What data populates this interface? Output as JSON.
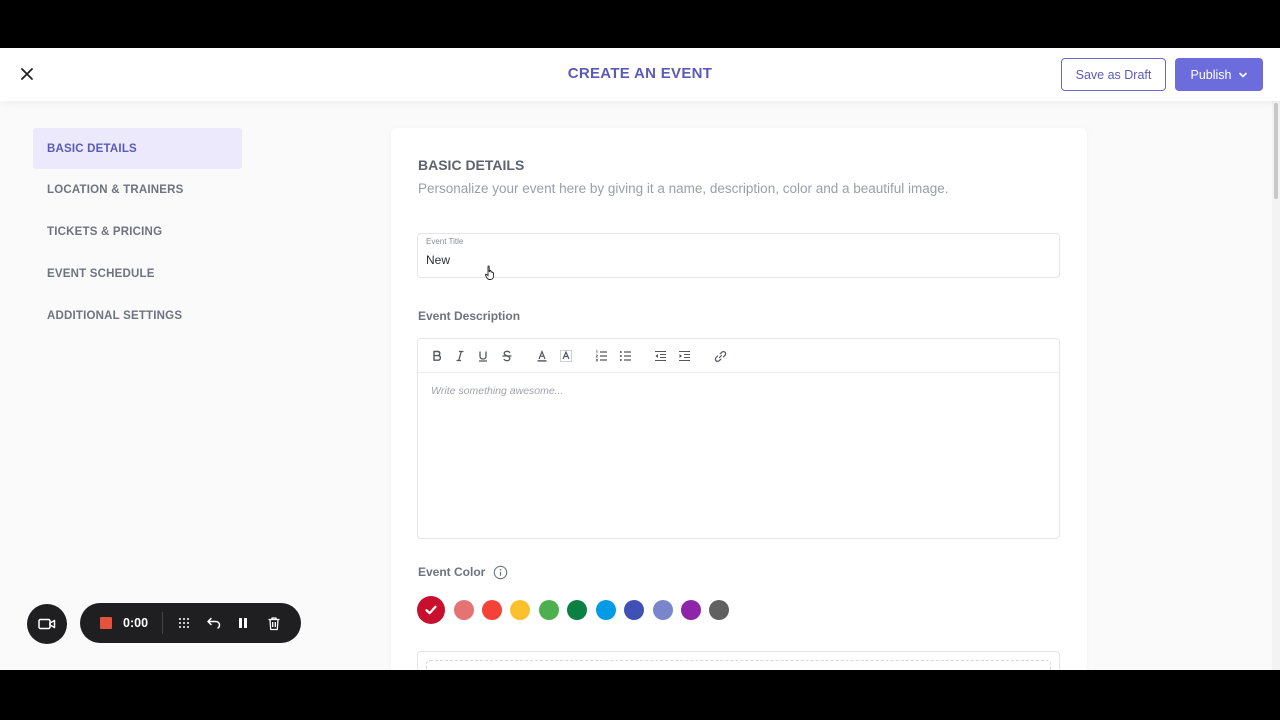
{
  "header": {
    "title": "CREATE AN EVENT",
    "save_draft_label": "Save as Draft",
    "publish_label": "Publish"
  },
  "sidebar": {
    "items": [
      {
        "label": "BASIC DETAILS",
        "active": true
      },
      {
        "label": "LOCATION & TRAINERS",
        "active": false
      },
      {
        "label": "TICKETS & PRICING",
        "active": false
      },
      {
        "label": "EVENT SCHEDULE",
        "active": false
      },
      {
        "label": "ADDITIONAL SETTINGS",
        "active": false
      }
    ]
  },
  "basic_details": {
    "title": "BASIC DETAILS",
    "subtitle": "Personalize your event here by giving it a name, description, color and a beautiful image.",
    "event_title_label": "Event Title",
    "event_title_value": "New",
    "description_label": "Event Description",
    "description_placeholder": "Write something awesome...",
    "color_label": "Event Color",
    "colors": [
      "#c8102e",
      "#e57373",
      "#f44336",
      "#fbc02d",
      "#4caf50",
      "#0b8043",
      "#039be5",
      "#3f51b5",
      "#7986cb",
      "#8e24aa",
      "#616161"
    ],
    "selected_color_index": 0
  },
  "recorder": {
    "time": "0:00"
  },
  "colors": {
    "accent": "#6c6cdc",
    "title": "#5b5bb7"
  }
}
